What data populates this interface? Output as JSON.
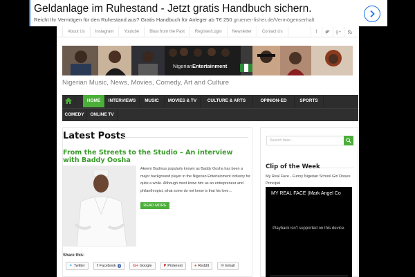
{
  "ad": {
    "title": "Geldanlage im Ruhestand - Jetzt gratis Handbuch sichern.",
    "description": "Reicht Ihr Vermögen für den Ruhestand aus? Gratis Handbuch für Anleger ab T€ 250",
    "url": "gruener-fisher.de/Vermögenserhalt"
  },
  "topbar": {
    "links": [
      "About Us",
      "Instagram",
      "Youtube",
      "Blast from the Past",
      "Register/Login",
      "Newsletter",
      "Contact Us"
    ],
    "social": [
      "facebook",
      "twitter",
      "google-plus",
      "rss"
    ]
  },
  "header": {
    "logo_text_1": "Nigerian",
    "logo_text_2": "Entertainment",
    "tagline": "Nigerian Music, News, Movies, Comedy, Art and Culture"
  },
  "nav": {
    "home": "HOME",
    "items": [
      "INTERVIEWS",
      "MUSIC",
      "MOVIES & TV",
      "CULTURE & ARTS",
      "OPINION-ED",
      "SPORTS"
    ],
    "items_row2": [
      "COMEDY",
      "ONLINE TV"
    ]
  },
  "main": {
    "heading": "Latest Posts",
    "post_title": "From the Streets to the Studio – An interview with Baddy Oosha",
    "excerpt": "Akeem Badmus popularly known as Baddy Oosha has been a major background player in the Nigerian Entertainment industry for quite a while. Although most know him as an entrepreneur and philanthropist, what some do not know is that his love…",
    "read_more": "READ MORE",
    "share_label": "Share this:",
    "share_buttons": [
      {
        "label": "Twitter",
        "icon": "twitter-icon"
      },
      {
        "label": "Facebook",
        "icon": "facebook-icon",
        "count": "1"
      },
      {
        "label": "Google",
        "icon": "google-plus-icon"
      },
      {
        "label": "Pinterest",
        "icon": "pinterest-icon"
      },
      {
        "label": "Reddit",
        "icon": "reddit-icon"
      },
      {
        "label": "Email",
        "icon": "email-icon"
      }
    ]
  },
  "sidebar": {
    "search_placeholder": "Search here...",
    "clip_title": "Clip of the Week",
    "clip_subtitle": "My Real Face - Funny Nigerian School Girl Disses Principal",
    "video_title": "MY REAL FACE (Mark Angel Co",
    "video_message": "Playback isn't supported on this device."
  },
  "colors": {
    "accent": "#4caf3a",
    "nav_bg": "#2d2d2d",
    "page_bg": "#000000"
  }
}
